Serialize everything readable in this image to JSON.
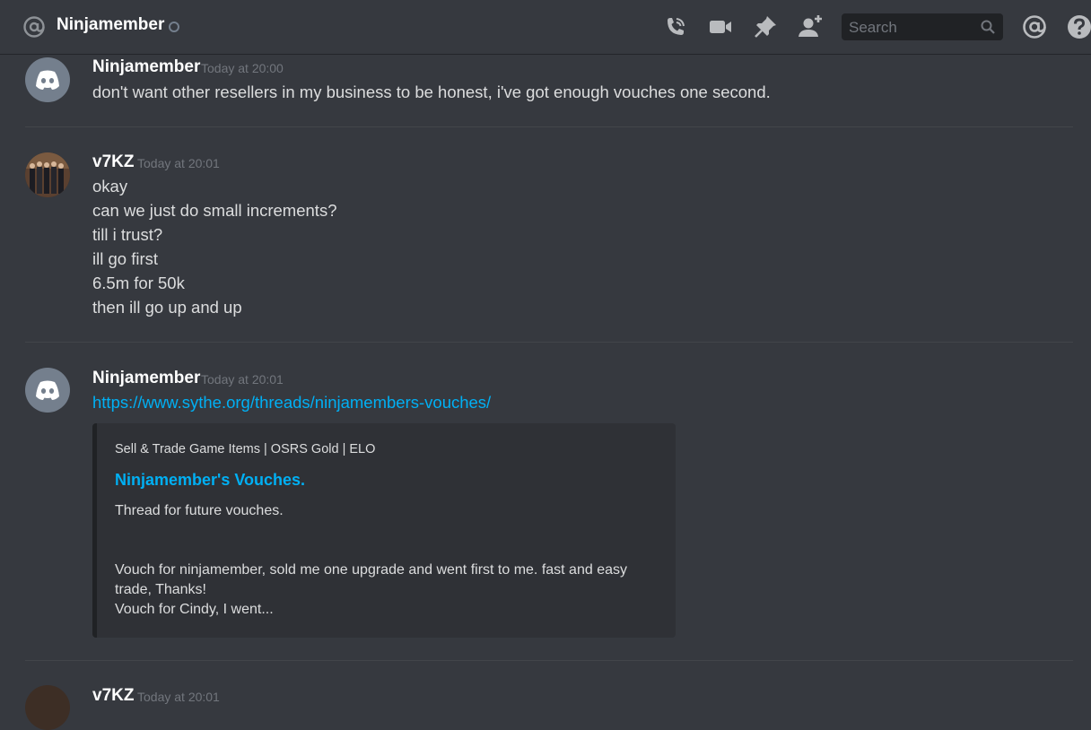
{
  "header": {
    "channel_name": "Ninjamember",
    "search_placeholder": "Search",
    "icons": [
      "at-icon",
      "status-dot",
      "call-icon",
      "video-icon",
      "pin-icon",
      "add-friend-icon",
      "search-icon",
      "mentions-icon",
      "help-icon"
    ]
  },
  "messages": [
    {
      "username": "Ninjamember",
      "timestamp": "Today at 20:00",
      "lines": [
        "don't want other resellers in my business to be honest, i've got enough vouches one second."
      ]
    },
    {
      "username": "v7KZ",
      "timestamp": "Today at 20:01",
      "lines": [
        "okay",
        "can we just do small increments?",
        "till i trust?",
        "ill go first",
        "6.5m for 50k",
        "then ill go up and up"
      ]
    },
    {
      "username": "Ninjamember",
      "timestamp": "Today at 20:01",
      "link": "https://www.sythe.org/threads/ninjamembers-vouches/",
      "embed": {
        "provider": "Sell & Trade Game Items | OSRS Gold | ELO",
        "title": "Ninjamember's Vouches.",
        "description": [
          "Thread for future vouches.",
          "Vouch for ninjamember, sold me one upgrade and went first to me. fast and easy",
          "trade, Thanks!",
          "Vouch for Cindy, I went..."
        ]
      }
    },
    {
      "username": "v7KZ",
      "timestamp": "Today at 20:01"
    }
  ],
  "colors": {
    "background": "#36393f",
    "link": "#00b0f4",
    "embed_bg": "#2f3136",
    "avatar_default": "#747f8d"
  }
}
